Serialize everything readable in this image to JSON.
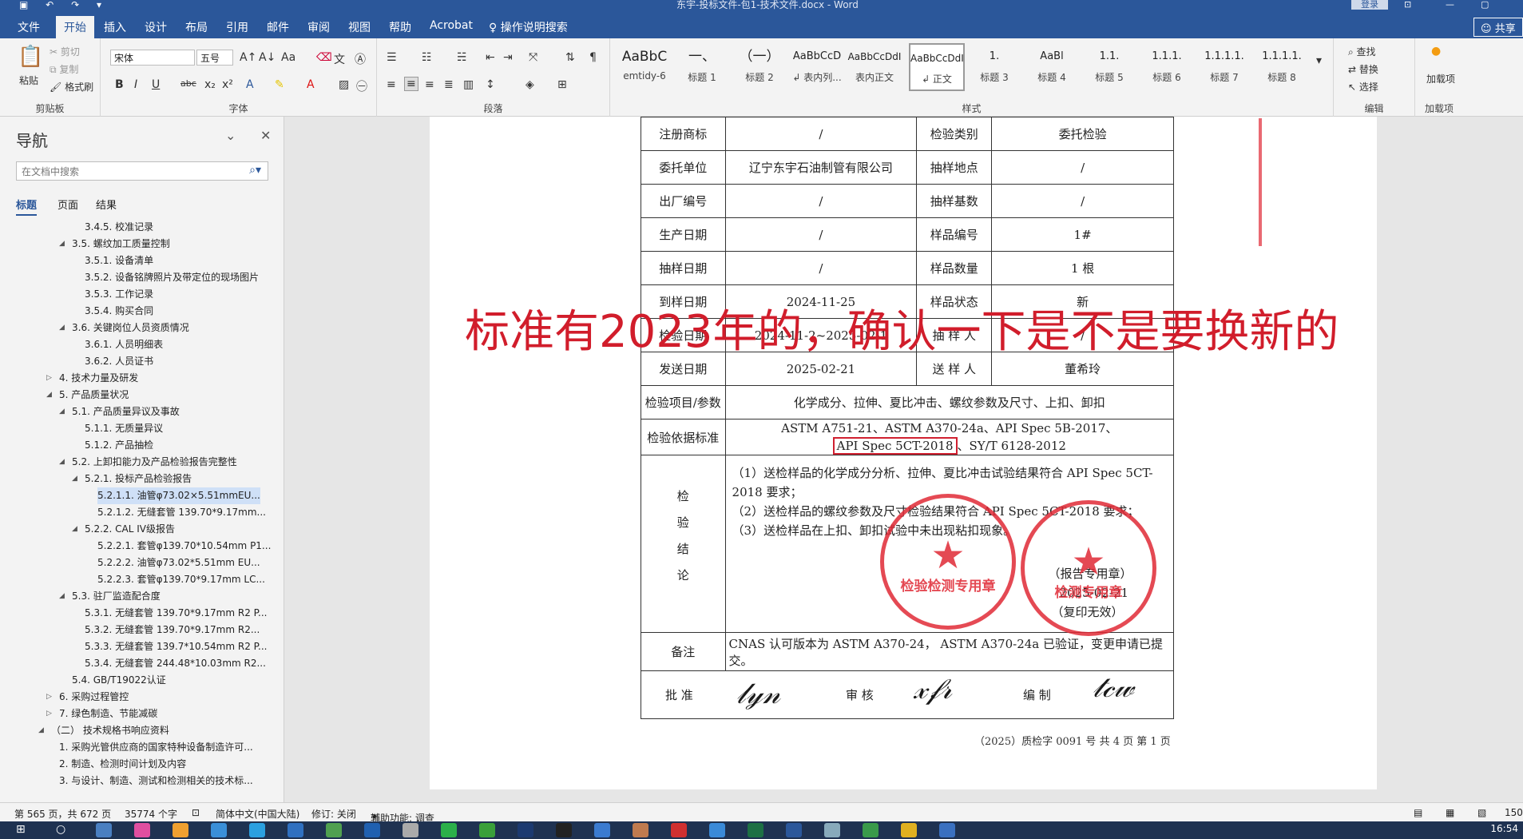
{
  "titlebar": {
    "doc_title": "东宇-投标文件-包1-技术文件.docx - Word",
    "login": "登录",
    "qa_icons": [
      "save-icon",
      "undo-icon",
      "redo-icon",
      "customize-icon"
    ]
  },
  "menu": {
    "tabs": [
      "文件",
      "开始",
      "插入",
      "设计",
      "布局",
      "引用",
      "邮件",
      "审阅",
      "视图",
      "帮助",
      "Acrobat"
    ],
    "tell_me": "操作说明搜索",
    "share": "共享"
  },
  "ribbon": {
    "clipboard": {
      "paste": "粘贴",
      "cut": "剪切",
      "copy": "复制",
      "format_painter": "格式刷",
      "label": "剪贴板"
    },
    "font": {
      "name": "宋体",
      "size": "五号",
      "label": "字体"
    },
    "paragraph": {
      "label": "段落"
    },
    "styles": {
      "label": "样式",
      "cards": [
        {
          "sample": "AaBbC",
          "name": "emtidy-6"
        },
        {
          "sample": "一、",
          "name": "标题 1"
        },
        {
          "sample": "（一）",
          "name": "标题 2"
        },
        {
          "sample": "AaBbCcD",
          "name": "↲ 表内列..."
        },
        {
          "sample": "AaBbCcDdI",
          "name": "表内正文"
        },
        {
          "sample": "AaBbCcDdI",
          "name": "↲ 正文"
        },
        {
          "sample": "1.",
          "name": "标题 3"
        },
        {
          "sample": "AaBl",
          "name": "标题 4"
        },
        {
          "sample": "1.1.",
          "name": "标题 5"
        },
        {
          "sample": "1.1.1.",
          "name": "标题 6"
        },
        {
          "sample": "1.1.1.1.",
          "name": "标题 7"
        },
        {
          "sample": "1.1.1.1.",
          "name": "标题 8"
        }
      ]
    },
    "editing": {
      "find": "查找",
      "replace": "替换",
      "select": "选择",
      "label": "编辑"
    },
    "addins": {
      "btn": "加载项",
      "label": "加载项"
    }
  },
  "nav": {
    "title": "导航",
    "search_placeholder": "在文档中搜索",
    "tabs": [
      "标题",
      "页面",
      "结果"
    ],
    "items": [
      {
        "text": "3.4.5. 校准记录",
        "level": 4
      },
      {
        "text": "3.5. 螺纹加工质量控制",
        "level": 3,
        "tri": "◢"
      },
      {
        "text": "3.5.1. 设备清单",
        "level": 4
      },
      {
        "text": "3.5.2. 设备铭牌照片及带定位的现场图片",
        "level": 4
      },
      {
        "text": "3.5.3. 工作记录",
        "level": 4
      },
      {
        "text": "3.5.4. 购买合同",
        "level": 4
      },
      {
        "text": "3.6. 关键岗位人员资质情况",
        "level": 3,
        "tri": "◢"
      },
      {
        "text": "3.6.1. 人员明细表",
        "level": 4
      },
      {
        "text": "3.6.2. 人员证书",
        "level": 4
      },
      {
        "text": "4. 技术力量及研发",
        "level": 2,
        "tri": "▷"
      },
      {
        "text": "5. 产品质量状况",
        "level": 2,
        "tri": "◢"
      },
      {
        "text": "5.1. 产品质量异议及事故",
        "level": 3,
        "tri": "◢"
      },
      {
        "text": "5.1.1. 无质量异议",
        "level": 4
      },
      {
        "text": "5.1.2. 产品抽检",
        "level": 4
      },
      {
        "text": "5.2. 上卸扣能力及产品检验报告完整性",
        "level": 3,
        "tri": "◢"
      },
      {
        "text": "5.2.1. 投标产品检验报告",
        "level": 4,
        "tri": "◢"
      },
      {
        "text": "5.2.1.1. 油管φ73.02×5.51mmEU...",
        "level": 5,
        "selected": true
      },
      {
        "text": "5.2.1.2. 无缝套管 139.70*9.17mm...",
        "level": 5
      },
      {
        "text": "5.2.2. CAL IV级报告",
        "level": 4,
        "tri": "◢"
      },
      {
        "text": "5.2.2.1. 套管φ139.70*10.54mm P1...",
        "level": 5
      },
      {
        "text": "5.2.2.2. 油管φ73.02*5.51mm EU...",
        "level": 5
      },
      {
        "text": "5.2.2.3. 套管φ139.70*9.17mm LC...",
        "level": 5
      },
      {
        "text": "5.3. 驻厂监造配合度",
        "level": 3,
        "tri": "◢"
      },
      {
        "text": "5.3.1. 无缝套管 139.70*9.17mm R2 P...",
        "level": 4
      },
      {
        "text": "5.3.2. 无缝套管 139.70*9.17mm R2...",
        "level": 4
      },
      {
        "text": "5.3.3. 无缝套管 139.7*10.54mm R2 P...",
        "level": 4
      },
      {
        "text": "5.3.4. 无缝套管 244.48*10.03mm R2...",
        "level": 4
      },
      {
        "text": "5.4. GB/T19022认证",
        "level": 3
      },
      {
        "text": "6. 采购过程管控",
        "level": 2,
        "tri": "▷"
      },
      {
        "text": "7. 绿色制造、节能减碳",
        "level": 2,
        "tri": "▷"
      },
      {
        "text": "（二） 技术规格书响应资料",
        "level": 1,
        "tri": "◢"
      },
      {
        "text": "1. 采购光管供应商的国家特种设备制造许可...",
        "level": 2
      },
      {
        "text": "2. 制造、检测时间计划及内容",
        "level": 2
      },
      {
        "text": "3. 与设计、制造、测试和检测相关的技术标...",
        "level": 2
      }
    ]
  },
  "document": {
    "rows": [
      [
        "注册商标",
        "/",
        "检验类别",
        "委托检验"
      ],
      [
        "委托单位",
        "辽宁东宇石油制管有限公司",
        "抽样地点",
        "/"
      ],
      [
        "出厂编号",
        "/",
        "抽样基数",
        "/"
      ],
      [
        "生产日期",
        "/",
        "样品编号",
        "1#"
      ],
      [
        "抽样日期",
        "/",
        "样品数量",
        "1 根"
      ],
      [
        "到样日期",
        "2024-11-25",
        "样品状态",
        "新"
      ],
      [
        "检验日期",
        "2024-11-2~2025-02-1",
        "抽 样 人",
        "/"
      ],
      [
        "发送日期",
        "2025-02-21",
        "送 样 人",
        "董希玲"
      ]
    ],
    "items_label": "检验项目/参数",
    "items_value": "化学成分、拉伸、夏比冲击、螺纹参数及尺寸、上扣、卸扣",
    "basis_label": "检验依据标准",
    "basis_line1": "ASTM A751-21、ASTM A370-24a、API Spec 5B-2017、",
    "basis_highlight": "API Spec 5CT-2018",
    "basis_rest": "、SY/T 6128-2012",
    "conclusion_label": "检验结论",
    "conclusion_lines": [
      "（1）送检样品的化学成分分析、拉伸、夏比冲击试验结果符合 API Spec 5CT-2018 要求；",
      "（2）送检样品的螺纹参数及尺寸检验结果符合 API Spec 5CT-2018 要求；",
      "（3）送检样品在上扣、卸扣试验中未出现粘扣现象。"
    ],
    "stamp_note": "（报告专用章）",
    "stamp_date": "2025-02-21",
    "stamp_copy": "（复印无效）",
    "remarks_label": "备注",
    "remarks_value": "CNAS 认可版本为 ASTM A370-24， ASTM A370-24a 已验证，变更申请已提交。",
    "sign_labels": [
      "批 准",
      "审 核",
      "编 制"
    ],
    "footer": "（2025）质检字 0091 号  共 4 页  第 1 页",
    "overlay": "标准有2023年的，确认一下是不是要换新的",
    "stamp1_text": "检验检测专用章",
    "stamp2_text": "检测专用章"
  },
  "status": {
    "page": "第 565 页，共 672 页",
    "words": "35774 个字",
    "lang": "简体中文(中国大陆)",
    "track": "修订: 关闭",
    "access": "辅助功能: 调查",
    "zoom": "150"
  },
  "taskbar": {
    "clock": "16:54"
  }
}
